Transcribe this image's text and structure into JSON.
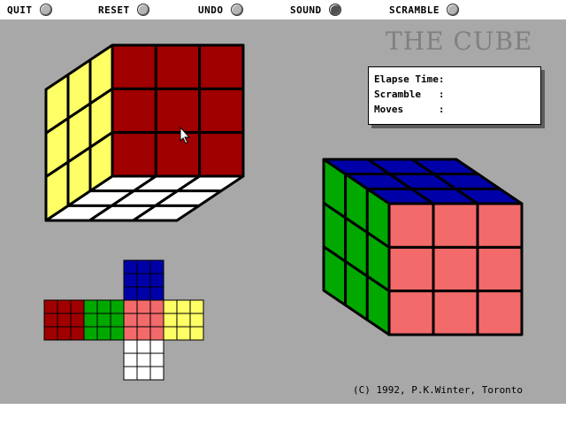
{
  "menu": {
    "items": [
      {
        "label": "QUIT",
        "state": "off"
      },
      {
        "label": "RESET",
        "state": "off"
      },
      {
        "label": "UNDO",
        "state": "off"
      },
      {
        "label": "SOUND",
        "state": "on"
      },
      {
        "label": "SCRAMBLE",
        "state": "off"
      }
    ]
  },
  "title": "THE CUBE",
  "info": {
    "elapse_time_label": "Elapse Time:",
    "scramble_label": "Scramble   :",
    "moves_label": "Moves      :"
  },
  "copyright": "(C) 1992, P.K.Winter, Toronto",
  "colors": {
    "background": "#a8a8a8",
    "menu_off": "#b4b4b4",
    "menu_on": "#505050",
    "red": "#a00000",
    "orange": "#f26a6a",
    "blue": "#0000a8",
    "green": "#00a800",
    "yellow": "#ffff66",
    "white": "#ffffff"
  },
  "cube_back_view": {
    "left_face": [
      "yellow",
      "yellow",
      "yellow",
      "yellow",
      "yellow",
      "yellow",
      "yellow",
      "yellow",
      "yellow"
    ],
    "back_face": [
      "red",
      "red",
      "red",
      "red",
      "red",
      "red",
      "red",
      "red",
      "red"
    ],
    "bottom_face": [
      "white",
      "white",
      "white",
      "white",
      "white",
      "white",
      "white",
      "white",
      "white"
    ]
  },
  "cube_front_view": {
    "top_face": [
      "blue",
      "blue",
      "blue",
      "blue",
      "blue",
      "blue",
      "blue",
      "blue",
      "blue"
    ],
    "left_face": [
      "green",
      "green",
      "green",
      "green",
      "green",
      "green",
      "green",
      "green",
      "green"
    ],
    "front_face": [
      "orange",
      "orange",
      "orange",
      "orange",
      "orange",
      "orange",
      "orange",
      "orange",
      "orange"
    ]
  },
  "cube_net": {
    "up": [
      "blue",
      "blue",
      "blue",
      "blue",
      "blue",
      "blue",
      "blue",
      "blue",
      "blue"
    ],
    "left": [
      "red",
      "red",
      "red",
      "red",
      "red",
      "red",
      "red",
      "red",
      "red"
    ],
    "front_left": [
      "green",
      "green",
      "green",
      "green",
      "green",
      "green",
      "green",
      "green",
      "green"
    ],
    "front": [
      "orange",
      "orange",
      "orange",
      "orange",
      "orange",
      "orange",
      "orange",
      "orange",
      "orange"
    ],
    "right": [
      "yellow",
      "yellow",
      "yellow",
      "yellow",
      "yellow",
      "yellow",
      "yellow",
      "yellow",
      "yellow"
    ],
    "down": [
      "white",
      "white",
      "white",
      "white",
      "white",
      "white",
      "white",
      "white",
      "white"
    ]
  }
}
